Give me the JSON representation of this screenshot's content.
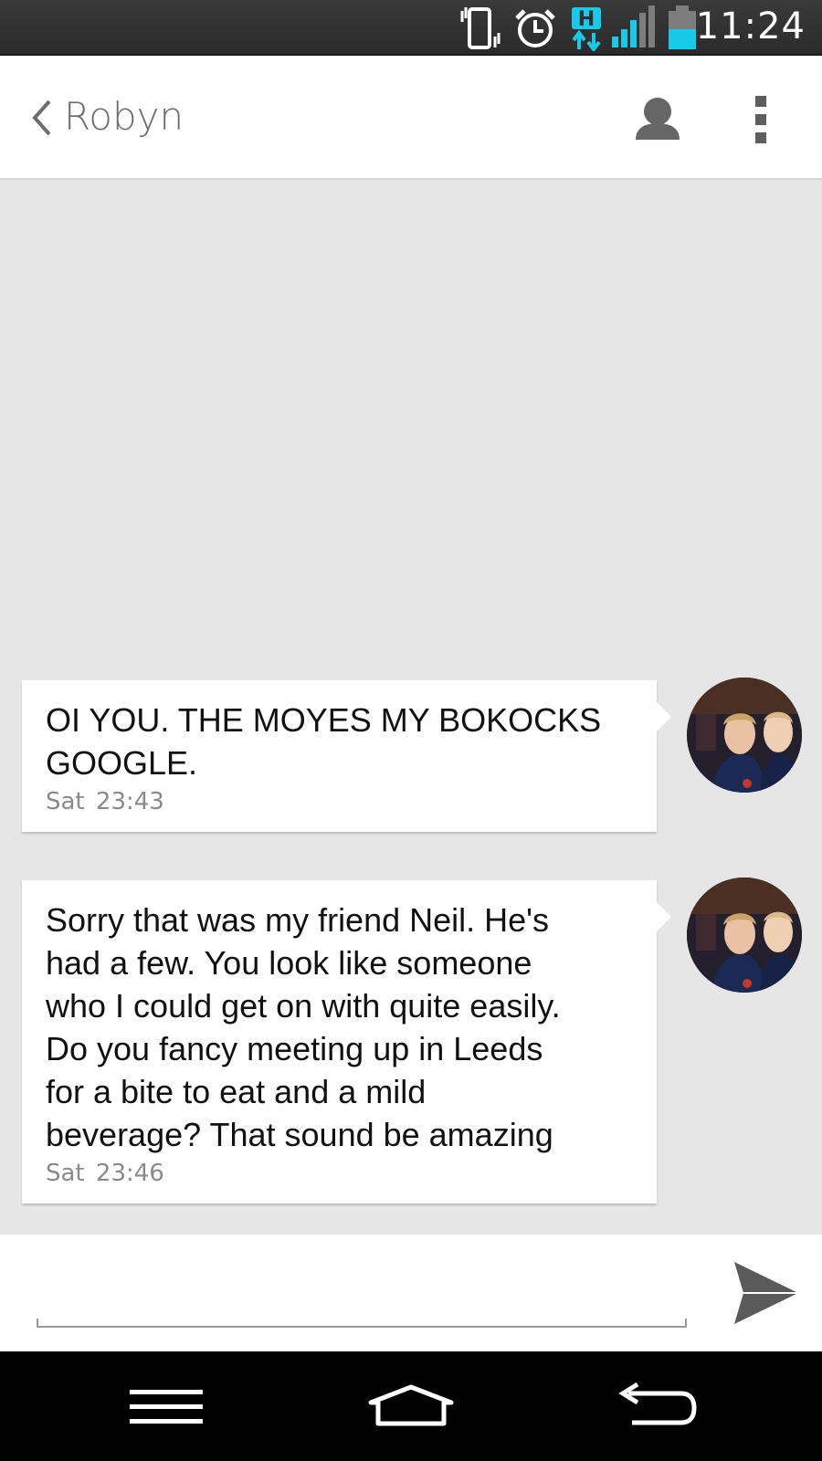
{
  "status_bar": {
    "time": "11:24",
    "icons": [
      "vibrate-icon",
      "alarm-icon",
      "hspa-data-icon",
      "signal-icon",
      "battery-icon"
    ],
    "colors": {
      "accent": "#19c9e8",
      "background": "#2e2e2e"
    }
  },
  "header": {
    "contact_name": "Robyn",
    "icons": [
      "back-chevron-icon",
      "contact-person-icon",
      "overflow-menu-icon"
    ]
  },
  "messages": [
    {
      "text": "OI YOU. THE MOYES MY BOKOCKS\nGOOGLE.",
      "time": "Sat  23:43"
    },
    {
      "text": "Sorry that was my friend Neil. He's\nhad a few. You look like someone\nwho I could get on with quite easily.\nDo you fancy meeting up in Leeds\nfor a bite to eat and a mild\nbeverage? That sound be amazing",
      "time": "Sat  23:46"
    }
  ],
  "composer": {
    "input_value": "",
    "placeholder": "",
    "send_icon": "send-icon"
  },
  "nav_bar": {
    "icons": [
      "menu-icon",
      "home-icon",
      "back-icon"
    ]
  }
}
